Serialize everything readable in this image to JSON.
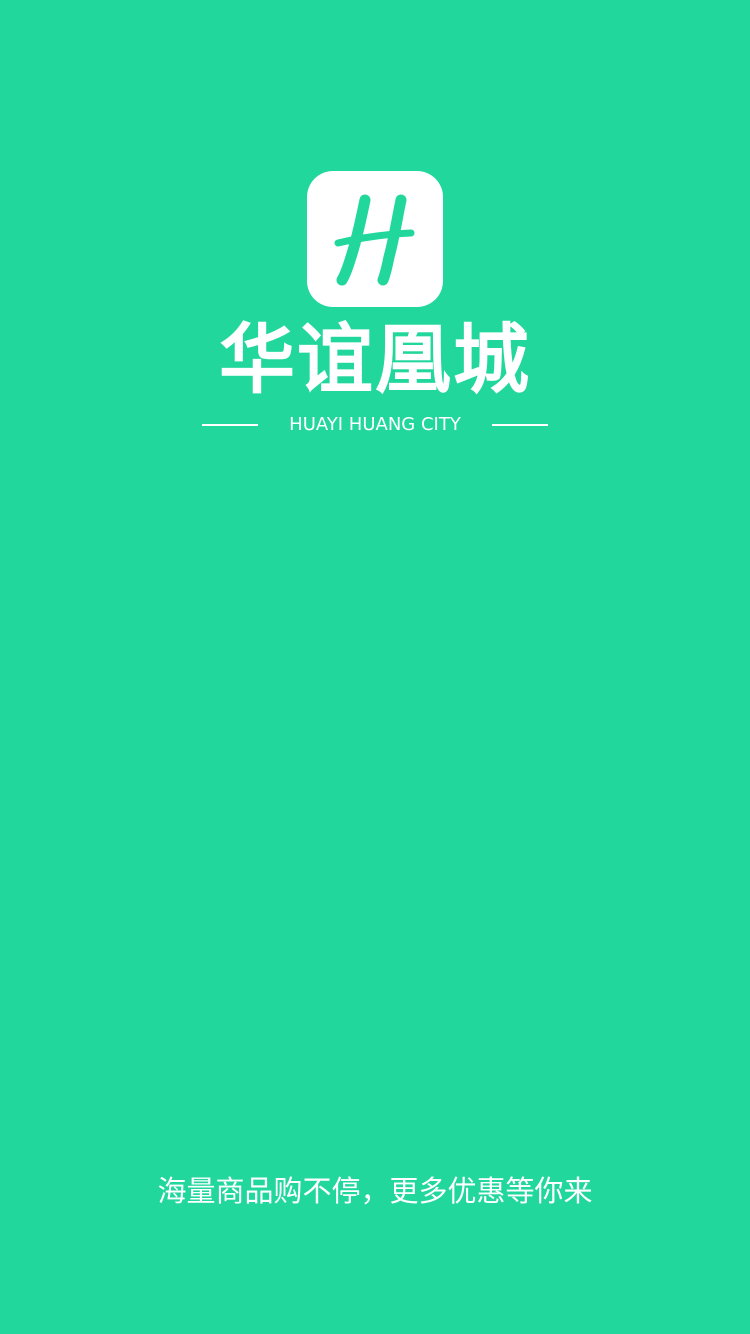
{
  "colors": {
    "background": "#21D79C",
    "logo_tile": "#FFFFFF",
    "logo_letter": "#21D79C",
    "text": "#FFFFFF"
  },
  "logo": {
    "letter": "H",
    "icon": "letter-h-icon"
  },
  "brand": {
    "name": "华谊凰城",
    "tagline": "HUAYI HUANG CITY"
  },
  "slogan": "海量商品购不停，更多优惠等你来"
}
